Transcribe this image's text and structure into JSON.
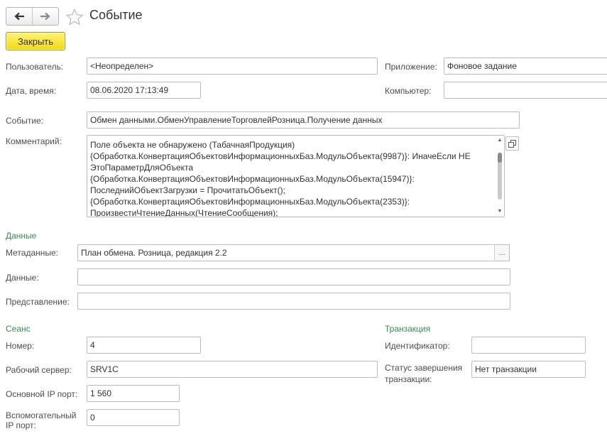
{
  "window": {
    "title": "Событие"
  },
  "toolbar": {
    "back_icon": "arrow-left-icon",
    "forward_icon": "arrow-right-icon",
    "favorite_icon": "star-icon",
    "close_label": "Закрыть"
  },
  "fields": {
    "user": {
      "label": "Пользователь:",
      "value": "<Неопределен>"
    },
    "app": {
      "label": "Приложение:",
      "value": "Фоновое задание"
    },
    "datetime": {
      "label": "Дата, время:",
      "value": "08.06.2020 17:13:49"
    },
    "computer": {
      "label": "Компьютер:",
      "value": ""
    },
    "event": {
      "label": "Событие:",
      "value": "Обмен данными.ОбменУправлениеТорговлейРозница.Получение данных"
    },
    "comment": {
      "label": "Комментарий:",
      "value": "Поле объекта не обнаружено (ТабачнаяПродукция)\n{Обработка.КонвертацияОбъектовИнформационныхБаз.МодульОбъекта(9987)}: ИначеЕсли НЕ ЭтоПараметрДляОбъекта\n{Обработка.КонвертацияОбъектовИнформационныхБаз.МодульОбъекта(15947)}: ПоследнийОбъектЗагрузки = ПрочитатьОбъект();\n{Обработка.КонвертацияОбъектовИнформационныхБаз.МодульОбъекта(2353)}: ПроизвестиЧтениеДанных(ЧтениеСообщения);"
    }
  },
  "data_section": {
    "heading": "Данные",
    "metadata": {
      "label": "Метаданные:",
      "value": "План обмена. Розница, редакция 2.2",
      "button": "..."
    },
    "data": {
      "label": "Данные:",
      "value": ""
    },
    "presentation": {
      "label": "Представление:",
      "value": ""
    }
  },
  "session_section": {
    "heading": "Сеанс",
    "number": {
      "label": "Номер:",
      "value": "4"
    },
    "server": {
      "label": "Рабочий сервер:",
      "value": "SRV1C"
    },
    "main_port": {
      "label": "Основной IP порт:",
      "value": "1 560"
    },
    "aux_port": {
      "label": "Вспомогательный\nIP порт:",
      "value": "0"
    }
  },
  "transaction_section": {
    "heading": "Транзакция",
    "id": {
      "label": "Идентификатор:",
      "value": ""
    },
    "status": {
      "label": "Статус завершения\nтранзакции:",
      "value": "Нет транзакции"
    }
  },
  "colors": {
    "section_heading": "#3b8a54",
    "close_button": "#f2d90f"
  }
}
